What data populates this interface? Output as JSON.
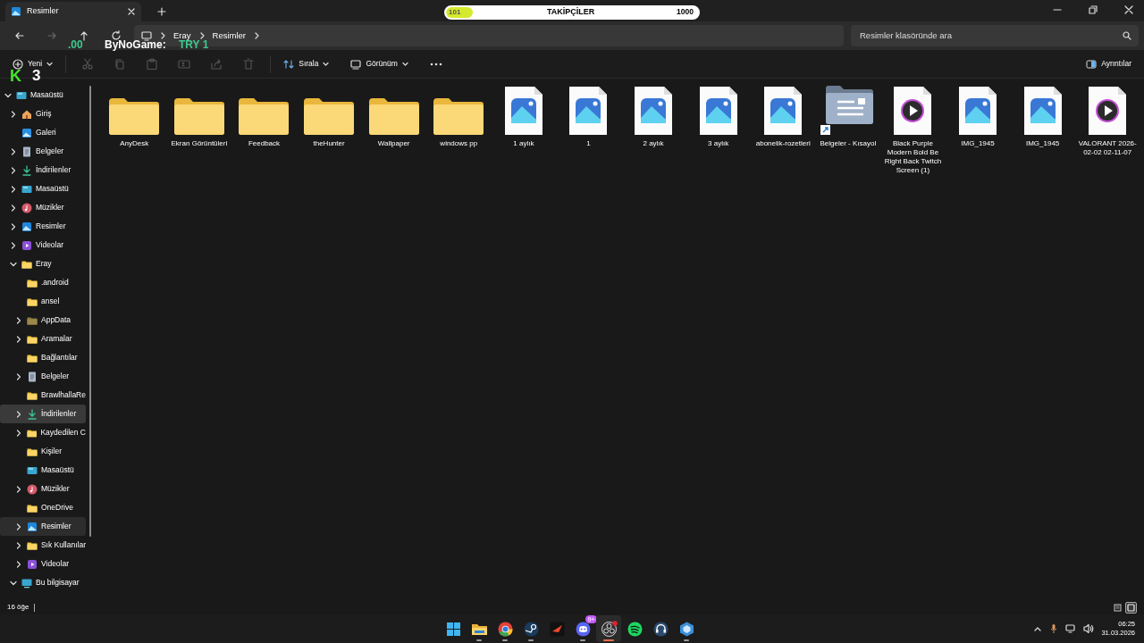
{
  "tab": {
    "title": "Resimler"
  },
  "nav": {
    "buttons": [
      {
        "kind": "back",
        "disabled": false
      },
      {
        "kind": "forward",
        "disabled": true
      },
      {
        "kind": "up",
        "disabled": false
      },
      {
        "kind": "refresh",
        "disabled": false
      }
    ],
    "breadcrumb": [
      "Eray",
      "Resimler"
    ],
    "search": {
      "placeholder": "Resimler klasöründe ara"
    }
  },
  "toolbar": {
    "new_label": "Yeni",
    "actions": [
      {
        "kind": "cut",
        "disabled": true
      },
      {
        "kind": "copy",
        "disabled": true
      },
      {
        "kind": "paste",
        "disabled": true
      },
      {
        "kind": "rename",
        "disabled": true
      },
      {
        "kind": "share",
        "disabled": true
      },
      {
        "kind": "delete",
        "disabled": true
      }
    ],
    "sort_label": "Sırala",
    "view_label": "Görünüm",
    "details_label": "Ayrıntılar"
  },
  "sidebar": {
    "tree": [
      {
        "label": "Masaüstü",
        "kind": "desktop",
        "expanded": true,
        "selected": false,
        "hovered": false,
        "children": [
          {
            "label": "Giriş",
            "kind": "home",
            "expanded": false,
            "selected": false,
            "hovered": false
          },
          {
            "label": "Galeri",
            "kind": "gallery",
            "selected": false,
            "hovered": false
          },
          {
            "label": "Belgeler",
            "kind": "docs",
            "expanded": false,
            "selected": false,
            "hovered": false
          },
          {
            "label": "İndirilenler",
            "kind": "download",
            "expanded": false,
            "selected": false,
            "hovered": false
          },
          {
            "label": "Masaüstü",
            "kind": "desktop",
            "expanded": false,
            "selected": false,
            "hovered": false
          },
          {
            "label": "Müzikler",
            "kind": "music",
            "expanded": false,
            "selected": false,
            "hovered": false
          },
          {
            "label": "Resimler",
            "kind": "pictures",
            "expanded": false,
            "selected": false,
            "hovered": false
          },
          {
            "label": "Videolar",
            "kind": "videos",
            "expanded": false,
            "selected": false,
            "hovered": false
          },
          {
            "label": "Eray",
            "kind": "folder",
            "expanded": true,
            "selected": false,
            "hovered": false,
            "children": [
              {
                "label": ".android",
                "kind": "folder",
                "selected": false,
                "hovered": false
              },
              {
                "label": "ansel",
                "kind": "folder",
                "selected": false,
                "hovered": false
              },
              {
                "label": "AppData",
                "kind": "folder-dim",
                "expanded": false,
                "selected": false,
                "hovered": false
              },
              {
                "label": "Aramalar",
                "kind": "folder",
                "expanded": false,
                "selected": false,
                "hovered": false
              },
              {
                "label": "Bağlantılar",
                "kind": "folder",
                "selected": false,
                "hovered": false
              },
              {
                "label": "Belgeler",
                "kind": "docs",
                "expanded": false,
                "selected": false,
                "hovered": false
              },
              {
                "label": "BrawlhallaRe",
                "kind": "folder",
                "selected": false,
                "hovered": false
              },
              {
                "label": "İndirilenler",
                "kind": "download",
                "expanded": false,
                "selected": false,
                "hovered": true
              },
              {
                "label": "Kaydedilen C",
                "kind": "folder",
                "expanded": false,
                "selected": false,
                "hovered": false
              },
              {
                "label": "Kişiler",
                "kind": "folder",
                "selected": false,
                "hovered": false
              },
              {
                "label": "Masaüstü",
                "kind": "desktop",
                "selected": false,
                "hovered": false
              },
              {
                "label": "Müzikler",
                "kind": "music",
                "expanded": false,
                "selected": false,
                "hovered": false
              },
              {
                "label": "OneDrive",
                "kind": "folder",
                "selected": false,
                "hovered": false
              },
              {
                "label": "Resimler",
                "kind": "pictures",
                "expanded": false,
                "selected": true,
                "hovered": false
              },
              {
                "label": "Sık Kullanılar",
                "kind": "folder",
                "expanded": false,
                "selected": false,
                "hovered": false
              },
              {
                "label": "Videolar",
                "kind": "videos",
                "expanded": false,
                "selected": false,
                "hovered": false
              }
            ]
          },
          {
            "label": "Bu bilgisayar",
            "kind": "pc",
            "expanded": true,
            "selected": false,
            "hovered": false
          }
        ]
      }
    ]
  },
  "files": [
    {
      "name": "AnyDesk",
      "kind": "folder"
    },
    {
      "name": "Ekran Görüntüleri",
      "kind": "folder"
    },
    {
      "name": "Feedback",
      "kind": "folder"
    },
    {
      "name": "theHunter",
      "kind": "folder"
    },
    {
      "name": "Wallpaper",
      "kind": "folder"
    },
    {
      "name": "windows pp",
      "kind": "folder"
    },
    {
      "name": "1 aylık",
      "kind": "image"
    },
    {
      "name": "1",
      "kind": "image"
    },
    {
      "name": "2 aylık",
      "kind": "image"
    },
    {
      "name": "3 aylık",
      "kind": "image"
    },
    {
      "name": "abonelik-rozetleri",
      "kind": "image"
    },
    {
      "name": "Belgeler - Kısayol",
      "kind": "shortcut"
    },
    {
      "name": "Black Purple Modern Bold Be Right Back Twitch Screen (1)",
      "kind": "video"
    },
    {
      "name": "IMG_1945",
      "kind": "image"
    },
    {
      "name": "IMG_1945",
      "kind": "image"
    },
    {
      "name": "VALORANT 2026-02-02 02-11-07",
      "kind": "video"
    }
  ],
  "status_bar": {
    "count": "16 öğe",
    "views": [
      {
        "kind": "details",
        "selected": false
      },
      {
        "kind": "tiles",
        "selected": true
      }
    ]
  },
  "overlay": {
    "follower_goal": {
      "label": "TAKİPÇİLER",
      "current": "101",
      "goal": "1000",
      "level": 0.1
    },
    "donation": {
      "amount": ".00",
      "name": "ByNoGame:",
      "value": "TRY 1"
    },
    "counter": {
      "letter": "K",
      "count": "3"
    }
  },
  "taskbar": {
    "apps": [
      {
        "kind": "start",
        "running": false,
        "active": false
      },
      {
        "kind": "explorer",
        "running": true,
        "active": false
      },
      {
        "kind": "chrome",
        "running": true,
        "active": false
      },
      {
        "kind": "steam",
        "running": true,
        "active": false
      },
      {
        "kind": "red-app",
        "running": false,
        "active": false
      },
      {
        "kind": "discord",
        "running": true,
        "active": false,
        "badge": "9+"
      },
      {
        "kind": "obs",
        "running": true,
        "active": true
      },
      {
        "kind": "spotify",
        "running": false,
        "active": false
      },
      {
        "kind": "headset",
        "running": false,
        "active": false
      },
      {
        "kind": "cube",
        "running": true,
        "active": false
      }
    ],
    "time": "06:25",
    "date": "31.03.2026"
  }
}
